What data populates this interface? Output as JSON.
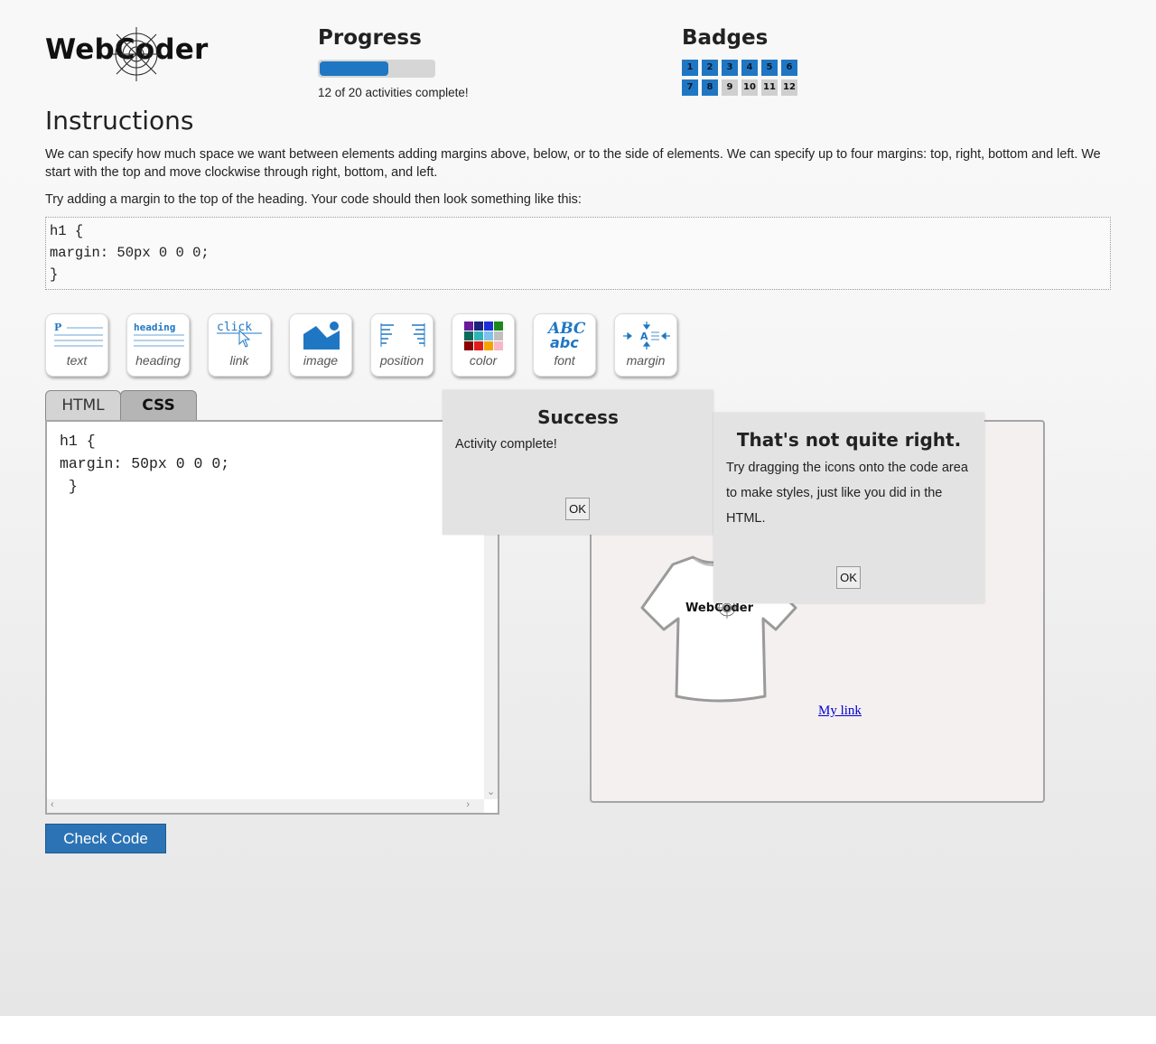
{
  "header": {
    "logo_text": "WebCoder",
    "progress": {
      "title": "Progress",
      "fraction": 0.6,
      "text": "12 of 20 activities complete!"
    },
    "badges": {
      "title": "Badges",
      "items": [
        {
          "label": "1",
          "earned": true
        },
        {
          "label": "2",
          "earned": true
        },
        {
          "label": "3",
          "earned": true
        },
        {
          "label": "4",
          "earned": true
        },
        {
          "label": "5",
          "earned": true
        },
        {
          "label": "6",
          "earned": true
        },
        {
          "label": "7",
          "earned": true
        },
        {
          "label": "8",
          "earned": true
        },
        {
          "label": "9",
          "earned": false
        },
        {
          "label": "10",
          "earned": false
        },
        {
          "label": "11",
          "earned": false
        },
        {
          "label": "12",
          "earned": false
        }
      ]
    }
  },
  "instructions": {
    "title": "Instructions",
    "paragraph1": "We can specify how much space we want between elements adding margins above, below, or to the side of elements. We can specify up to four margins: top, right, bottom and left. We start with the top and move clockwise through right, bottom, and left.",
    "paragraph2": "Try adding a margin to the top of the heading. Your code should then look something like this:",
    "code_lines": [
      "h1 {",
      "margin: 50px 0 0 0;",
      "}"
    ]
  },
  "toolbar": {
    "tools": [
      {
        "label": "text",
        "icon": "text-icon",
        "glyph_text": "P"
      },
      {
        "label": "heading",
        "icon": "heading-icon",
        "glyph_text": "heading"
      },
      {
        "label": "link",
        "icon": "link-icon",
        "glyph_text": "click"
      },
      {
        "label": "image",
        "icon": "image-icon"
      },
      {
        "label": "position",
        "icon": "position-icon"
      },
      {
        "label": "color",
        "icon": "color-icon"
      },
      {
        "label": "font",
        "icon": "font-icon",
        "glyph_text": "ABC",
        "glyph_text2": "abc"
      },
      {
        "label": "margin",
        "icon": "margin-icon",
        "glyph_text": "A"
      }
    ]
  },
  "tabs": {
    "html_label": "HTML",
    "css_label": "CSS",
    "active": "CSS"
  },
  "editor": {
    "lines": [
      "h1 {",
      "margin: 50px 0 0 0;",
      " }"
    ]
  },
  "preview": {
    "tshirt_text": "WebCoder",
    "link_text": "My link"
  },
  "dialogs": {
    "success": {
      "title": "Success",
      "message": "Activity complete!",
      "ok_label": "OK"
    },
    "error": {
      "title": "That's not quite right.",
      "message": "Try dragging the icons onto the code area to make styles, just like you did in the HTML.",
      "ok_label": "OK"
    }
  },
  "check_code_label": "Check Code",
  "colors": {
    "accent_blue": "#1f77c4",
    "button_blue": "#2c73b5",
    "link_blue": "#0000cc",
    "dialog_bg": "#e3e3e3"
  }
}
